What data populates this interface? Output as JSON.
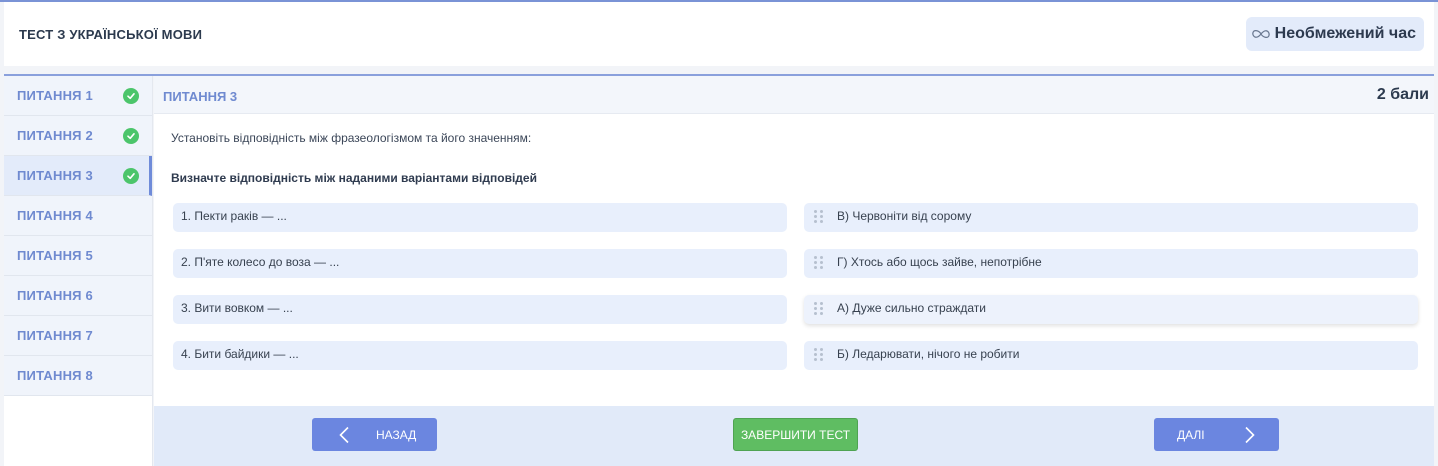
{
  "header": {
    "title": "ТЕСТ З УКРАЇНСЬКОЇ МОВИ",
    "timer_icon": "infinity-icon",
    "timer_label": "Необмежений час"
  },
  "sidebar": {
    "items": [
      {
        "label": "ПИТАННЯ 1",
        "answered": true
      },
      {
        "label": "ПИТАННЯ 2",
        "answered": true
      },
      {
        "label": "ПИТАННЯ 3",
        "answered": true,
        "active": true
      },
      {
        "label": "ПИТАННЯ 4",
        "answered": false
      },
      {
        "label": "ПИТАННЯ 5",
        "answered": false
      },
      {
        "label": "ПИТАННЯ 6",
        "answered": false
      },
      {
        "label": "ПИТАННЯ 7",
        "answered": false
      },
      {
        "label": "ПИТАННЯ 8",
        "answered": false
      }
    ]
  },
  "question": {
    "title": "ПИТАННЯ 3",
    "points": "2 бали",
    "instruction": "Установіть відповідність між фразеологізмом та його значенням:",
    "prompt": "Визначте відповідність між наданими варіантами відповідей",
    "left_items": [
      "1. Пекти раків — ...",
      "2. П'яте колесо до воза — ...",
      "3. Вити вовком — ...",
      "4. Бити байдики — ..."
    ],
    "right_items": [
      "В) Червоніти від сорому",
      "Г) Хтось або щось зайве, непотрібне",
      "А) Дуже сильно страждати",
      "Б) Ледарювати, нічого не робити"
    ]
  },
  "footer": {
    "back_label": "НАЗАД",
    "finish_label": "ЗАВЕРШИТИ ТЕСТ",
    "next_label": "ДАЛІ"
  },
  "colors": {
    "accent": "#6b86e0",
    "success": "#5fbd62",
    "check": "#4cc56b",
    "nav_text": "#6f8ad0"
  }
}
